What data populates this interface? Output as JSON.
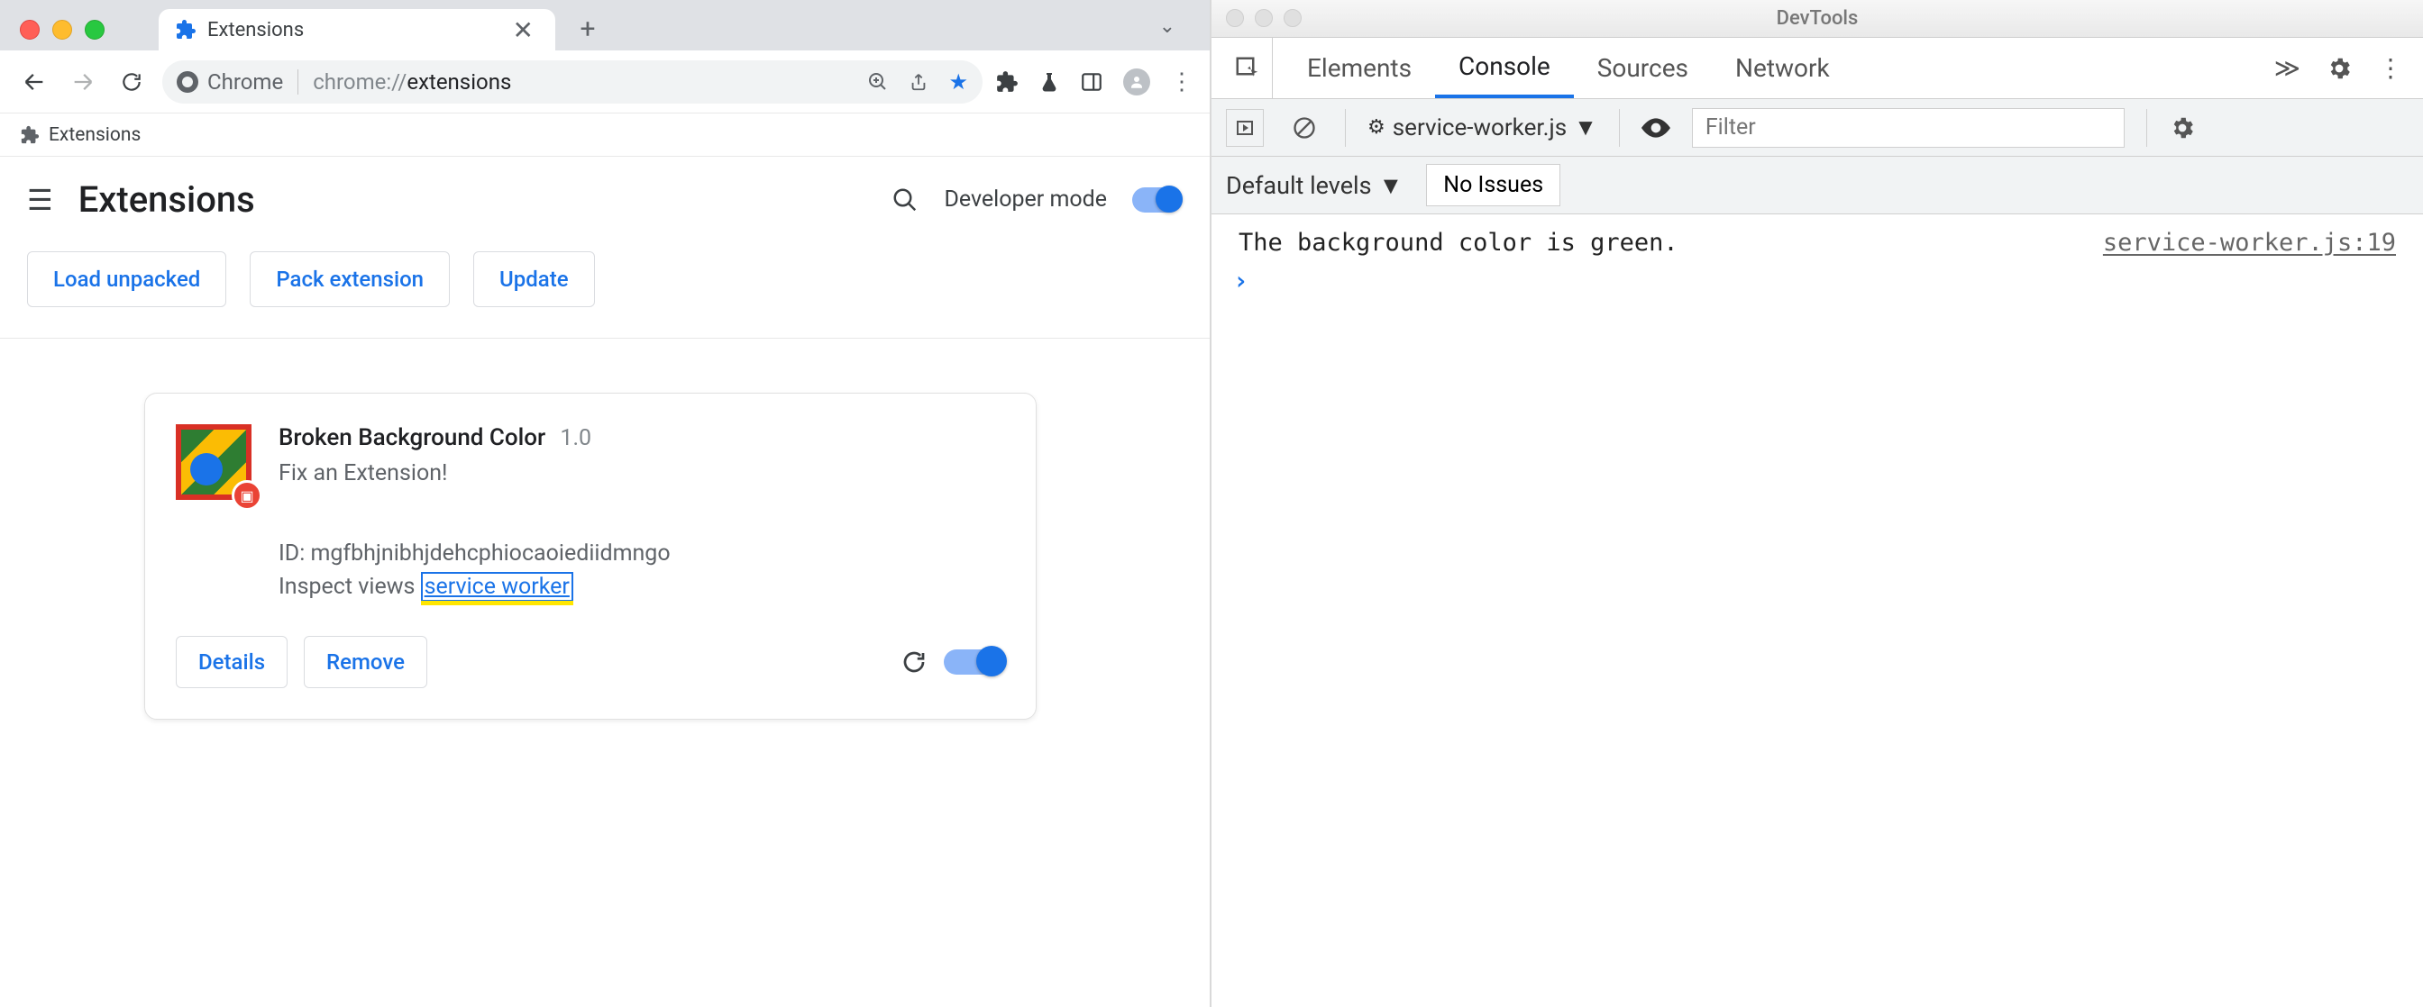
{
  "chrome": {
    "tab": {
      "title": "Extensions"
    },
    "omnibox": {
      "host": "Chrome",
      "scheme": "chrome://",
      "path": "extensions"
    },
    "bookmarks": {
      "extensions": "Extensions"
    },
    "page": {
      "title": "Extensions",
      "developer_mode": "Developer mode",
      "buttons": {
        "load": "Load unpacked",
        "pack": "Pack extension",
        "update": "Update"
      }
    },
    "card": {
      "name": "Broken Background Color",
      "version": "1.0",
      "description": "Fix an Extension!",
      "id_label": "ID:",
      "id_value": "mgfbhjnibhjdehcphiocaoiediidmngo",
      "inspect_label": "Inspect views",
      "inspect_link": "service worker",
      "details": "Details",
      "remove": "Remove"
    }
  },
  "devtools": {
    "window_title": "DevTools",
    "tabs": {
      "elements": "Elements",
      "console": "Console",
      "sources": "Sources",
      "network": "Network"
    },
    "context": "service-worker.js",
    "filter_placeholder": "Filter",
    "levels": "Default levels",
    "issues": "No Issues",
    "msg": "The background color is green.",
    "msg_src": "service-worker.js:19"
  }
}
